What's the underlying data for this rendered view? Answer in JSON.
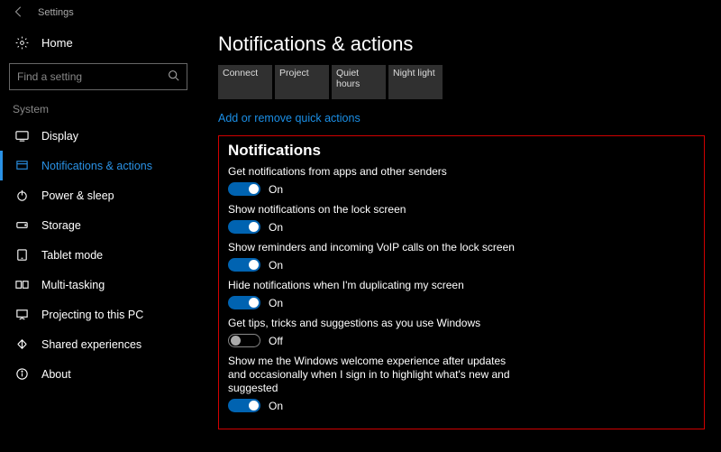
{
  "app_title": "Settings",
  "home_label": "Home",
  "search_placeholder": "Find a setting",
  "sidebar_group": "System",
  "nav": [
    {
      "label": "Display"
    },
    {
      "label": "Notifications & actions"
    },
    {
      "label": "Power & sleep"
    },
    {
      "label": "Storage"
    },
    {
      "label": "Tablet mode"
    },
    {
      "label": "Multi-tasking"
    },
    {
      "label": "Projecting to this PC"
    },
    {
      "label": "Shared experiences"
    },
    {
      "label": "About"
    }
  ],
  "page_title": "Notifications & actions",
  "quick_actions": [
    {
      "label": "Connect"
    },
    {
      "label": "Project"
    },
    {
      "label": "Quiet hours"
    },
    {
      "label": "Night light"
    }
  ],
  "quick_link": "Add or remove quick actions",
  "section_header": "Notifications",
  "options": [
    {
      "label": "Get notifications from apps and other senders",
      "on": true,
      "state": "On"
    },
    {
      "label": "Show notifications on the lock screen",
      "on": true,
      "state": "On"
    },
    {
      "label": "Show reminders and incoming VoIP calls on the lock screen",
      "on": true,
      "state": "On"
    },
    {
      "label": "Hide notifications when I'm duplicating my screen",
      "on": true,
      "state": "On"
    },
    {
      "label": "Get tips, tricks and suggestions as you use Windows",
      "on": false,
      "state": "Off"
    },
    {
      "label": "Show me the Windows welcome experience after updates and occasionally when I sign in to highlight what's new and suggested",
      "on": true,
      "state": "On"
    }
  ]
}
